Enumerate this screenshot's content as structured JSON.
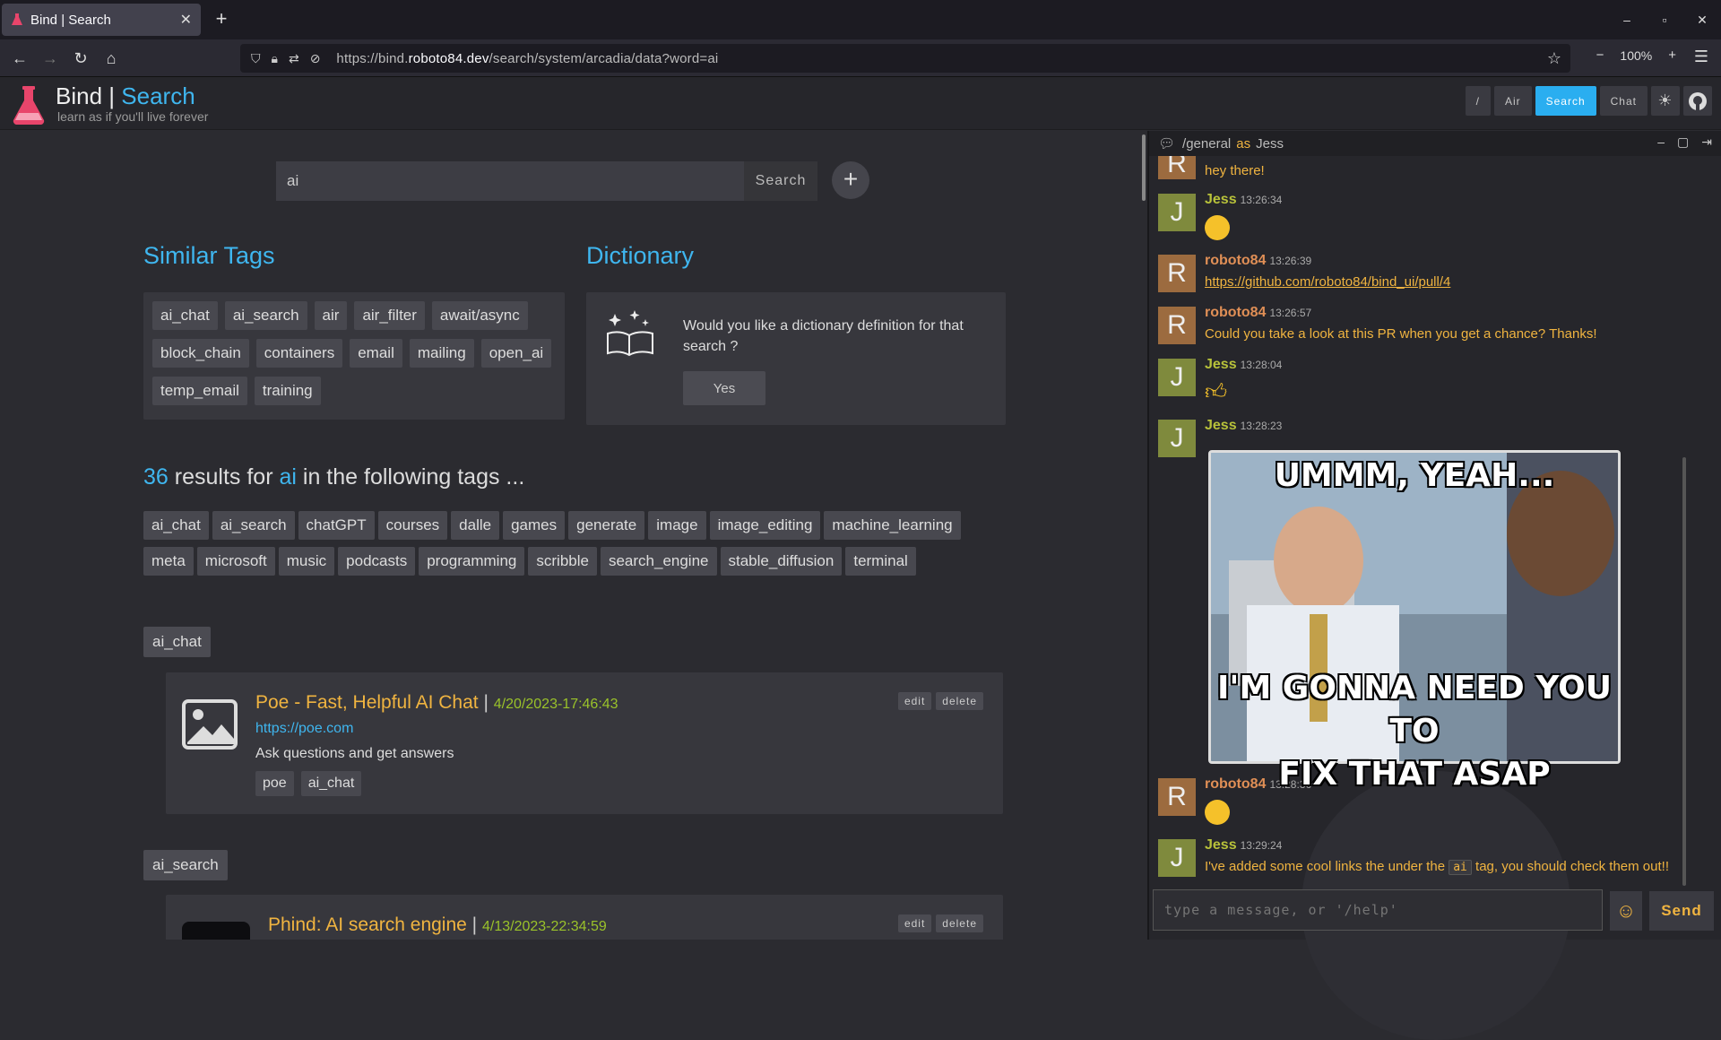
{
  "browser": {
    "tab_title": "Bind | Search",
    "url_prefix": "https://bind.",
    "url_domain": "roboto84.dev",
    "url_path": "/search/system/arcadia/data?word=ai",
    "zoom": "100%"
  },
  "header": {
    "brand_left": "Bind",
    "brand_sep": "|",
    "brand_right": "Search",
    "tagline": "learn as if you'll live forever",
    "nav": [
      "/",
      "Air",
      "Search",
      "Chat"
    ]
  },
  "search": {
    "value": "ai",
    "button": "Search",
    "add": "+"
  },
  "similar_tags": {
    "heading": "Similar Tags",
    "tags": [
      "ai_chat",
      "ai_search",
      "air",
      "air_filter",
      "await/async",
      "block_chain",
      "containers",
      "email",
      "mailing",
      "open_ai",
      "temp_email",
      "training"
    ]
  },
  "dictionary": {
    "heading": "Dictionary",
    "prompt": "Would you like a dictionary definition for that search ?",
    "yes": "Yes"
  },
  "results": {
    "count": "36",
    "mid1": "results for",
    "word": "ai",
    "mid2": "in the following tags ...",
    "tags": [
      "ai_chat",
      "ai_search",
      "chatGPT",
      "courses",
      "dalle",
      "games",
      "generate",
      "image",
      "image_editing",
      "machine_learning",
      "meta",
      "microsoft",
      "music",
      "podcasts",
      "programming",
      "scribble",
      "search_engine",
      "stable_diffusion",
      "terminal"
    ]
  },
  "groups": [
    {
      "tag": "ai_chat",
      "title": "Poe - Fast, Helpful AI Chat",
      "date": "4/20/2023-17:46:43",
      "link": "https://poe.com",
      "desc": "Ask questions and get answers",
      "tags": [
        "poe",
        "ai_chat"
      ],
      "edit": "edit",
      "delete": "delete"
    },
    {
      "tag": "ai_search",
      "title": "Phind: AI search engine",
      "date": "4/13/2023-22:34:59",
      "edit": "edit",
      "delete": "delete"
    }
  ],
  "chat": {
    "channel": "/general",
    "as_label": "as",
    "user": "Jess",
    "messages": [
      {
        "avatar": "R",
        "text": "hey there!"
      },
      {
        "avatar": "J",
        "name": "Jess",
        "time": "13:26:34",
        "emoji": "yum"
      },
      {
        "avatar": "R",
        "name": "roboto84",
        "time": "13:26:39",
        "link": "https://github.com/roboto84/bind_ui/pull/4"
      },
      {
        "avatar": "R",
        "name": "roboto84",
        "time": "13:26:57",
        "text": "Could you take a look at this PR when you get a chance? Thanks!"
      },
      {
        "avatar": "J",
        "name": "Jess",
        "time": "13:28:04",
        "emoji": "thumbs-up"
      },
      {
        "avatar": "J",
        "name": "Jess",
        "time": "13:28:23",
        "meme_top": "UMMM, YEAH...",
        "meme_bottom1": "I'M GONNA NEED YOU TO",
        "meme_bottom2": "FIX THAT ASAP"
      },
      {
        "avatar": "R",
        "name": "roboto84",
        "time": "13:28:36",
        "emoji": "rofl"
      },
      {
        "avatar": "J",
        "name": "Jess",
        "time": "13:29:24",
        "text_before": "I've added some cool links the under the",
        "code": "ai",
        "text_after": "tag, you should check them out!!"
      }
    ],
    "placeholder": "type a message, or '/help'",
    "send": "Send"
  },
  "colors": {
    "accent": "#3fb6ef",
    "gold": "#f0b440",
    "green": "#9ac22a"
  }
}
